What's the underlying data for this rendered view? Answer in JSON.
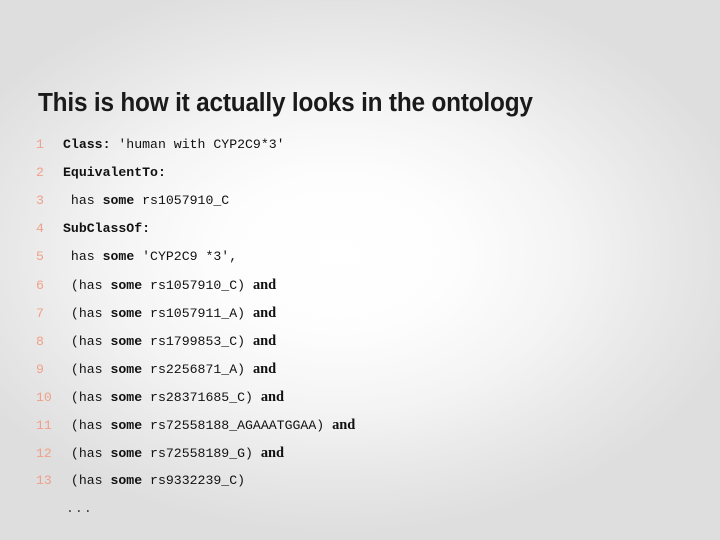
{
  "slide": {
    "title": "This is how it actually looks in the ontology",
    "ellipsis": "...",
    "colors": {
      "line_number": "#f0a08a",
      "code_text": "#111111",
      "title_text": "#1a1a1a",
      "background_center": "#ffffff",
      "background_edge": "#dedede"
    }
  },
  "code": {
    "lines": [
      {
        "number": "1",
        "text": "Class: 'human with CYP2C9*3'",
        "keyword": "Class:",
        "payload": " 'human with CYP2C9*3'",
        "conjunction": ""
      },
      {
        "number": "2",
        "text": "EquivalentTo:",
        "keyword": "EquivalentTo:",
        "payload": "",
        "conjunction": ""
      },
      {
        "number": "3",
        "text": " has some rs1057910_C",
        "prefix": " has ",
        "keyword": "some",
        "payload": " rs1057910_C",
        "conjunction": ""
      },
      {
        "number": "4",
        "text": "SubClassOf:",
        "keyword": "SubClassOf:",
        "payload": "",
        "conjunction": ""
      },
      {
        "number": "5",
        "text": " has some 'CYP2C9 *3',",
        "prefix": " has ",
        "keyword": "some",
        "payload": " 'CYP2C9 *3',",
        "conjunction": ""
      },
      {
        "number": "6",
        "text": " (has some rs1057910_C) and",
        "prefix": " (has ",
        "keyword": "some",
        "payload": " rs1057910_C) ",
        "conjunction": "and"
      },
      {
        "number": "7",
        "text": " (has some rs1057911_A) and",
        "prefix": " (has ",
        "keyword": "some",
        "payload": " rs1057911_A) ",
        "conjunction": "and"
      },
      {
        "number": "8",
        "text": " (has some rs1799853_C) and",
        "prefix": " (has ",
        "keyword": "some",
        "payload": " rs1799853_C) ",
        "conjunction": "and"
      },
      {
        "number": "9",
        "text": " (has some rs2256871_A) and",
        "prefix": " (has ",
        "keyword": "some",
        "payload": " rs2256871_A) ",
        "conjunction": "and"
      },
      {
        "number": "10",
        "text": " (has some rs28371685_C) and",
        "prefix": " (has ",
        "keyword": "some",
        "payload": " rs28371685_C) ",
        "conjunction": "and"
      },
      {
        "number": "11",
        "text": " (has some rs72558188_AGAAATGGAA) and",
        "prefix": " (has ",
        "keyword": "some",
        "payload": " rs72558188_AGAAATGGAA) ",
        "conjunction": "and"
      },
      {
        "number": "12",
        "text": " (has some rs72558189_G) and",
        "prefix": " (has ",
        "keyword": "some",
        "payload": " rs72558189_G) ",
        "conjunction": "and"
      },
      {
        "number": "13",
        "text": " (has some rs9332239_C)",
        "prefix": " (has ",
        "keyword": "some",
        "payload": " rs9332239_C)",
        "conjunction": ""
      }
    ]
  }
}
